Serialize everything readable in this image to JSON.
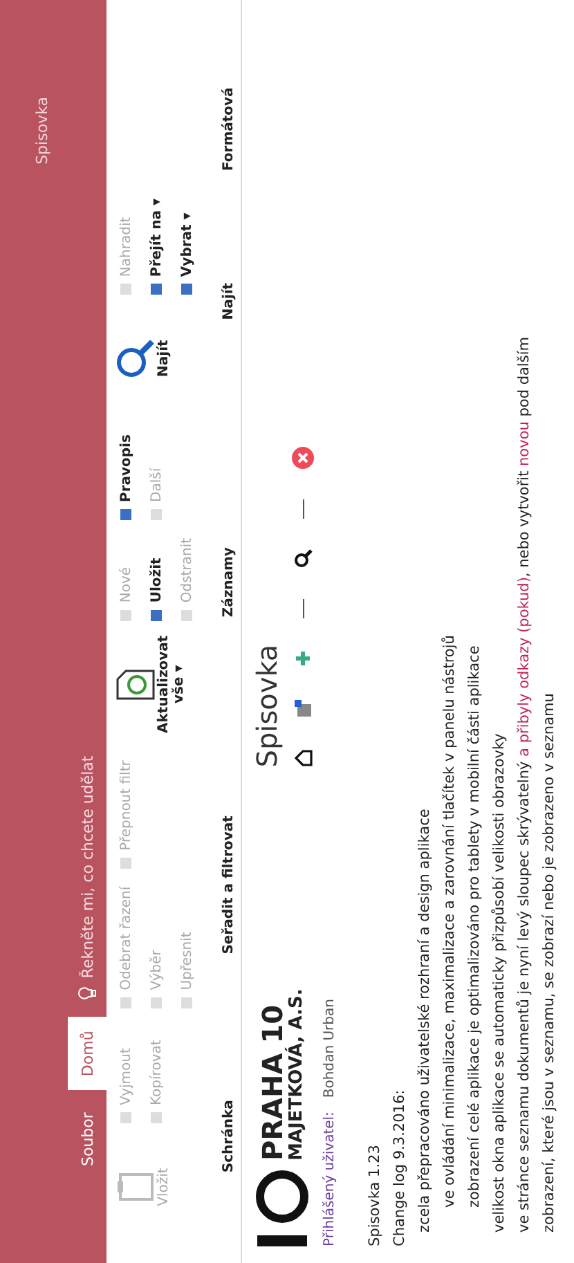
{
  "window": {
    "title": "Spisovka"
  },
  "tabs": [
    {
      "label": "Soubor",
      "selected": false
    },
    {
      "label": "Domů",
      "selected": true
    }
  ],
  "tell_me": {
    "placeholder": "Řekněte mi, co chcete udělat"
  },
  "ribbon": {
    "groups": [
      {
        "label": "Schránka",
        "large": {
          "label": "Vložit",
          "disabled": true
        },
        "columns": [
          [
            {
              "label": "Vyjmout",
              "disabled": true
            },
            {
              "label": "Kopírovat",
              "disabled": true
            }
          ]
        ]
      },
      {
        "label": "Seřadit a filtrovat",
        "columns": [
          [
            {
              "label": "Odebrat řazení",
              "disabled": true
            },
            {
              "label": "Výběr",
              "disabled": true
            },
            {
              "label": "Upřesnit",
              "disabled": true
            }
          ],
          [
            {
              "label": "Přepnout filtr",
              "disabled": true
            }
          ]
        ]
      },
      {
        "label": "Záznamy",
        "large": {
          "label": "Aktualizovat vše ▾",
          "disabled": false
        },
        "columns": [
          [
            {
              "label": "Nové",
              "disabled": true
            },
            {
              "label": "Uložit",
              "disabled": false
            },
            {
              "label": "Odstranit",
              "disabled": true
            }
          ],
          [
            {
              "label": "Pravopis",
              "disabled": false
            },
            {
              "label": "Další",
              "disabled": true
            }
          ]
        ]
      },
      {
        "label": "Najít",
        "large": {
          "label": "Najít",
          "disabled": false
        },
        "columns": [
          [
            {
              "label": "Nahradit",
              "disabled": true
            },
            {
              "label": "Přejít na ▾",
              "disabled": false
            },
            {
              "label": "Vybrat ▾",
              "disabled": false
            }
          ]
        ]
      },
      {
        "label": "Formátová"
      }
    ]
  },
  "logo": {
    "line_1": "PRAHA 10",
    "line_2": "MAJETKOVÁ, A.S."
  },
  "page_title": "Spisovka",
  "user": {
    "label": "Přihlášený uživatel:",
    "name": "Bohdan Urban"
  },
  "version": "Spisovka 1.23",
  "changelog": {
    "title": "Change log 9.3.2016:",
    "items": [
      {
        "segments": [
          {
            "text": "zcela přepracováno uživatelské rozhraní a design aplikace",
            "highlighted": false
          }
        ],
        "children": [
          {
            "segments": [
              {
                "text": "ve ovládání minimalizace, maximalizace a zarovnání tlačítek v panelu nástrojů",
                "highlighted": false
              }
            ]
          },
          {
            "segments": [
              {
                "text": "zobrazení celé aplikace je optimalizováno pro tablety v mobilní části aplikace",
                "highlighted": false
              }
            ]
          }
        ]
      },
      {
        "segments": [
          {
            "text": "velikost okna aplikace se automaticky přizpůsobí velikosti obrazovky",
            "highlighted": false
          }
        ]
      },
      {
        "segments": [
          {
            "text": "ve stránce seznamu dokumentů je nyní levý sloupec skrývatelný ",
            "highlighted": false
          },
          {
            "text": "a přibyly odkazy (pokud)",
            "highlighted": true
          },
          {
            "text": ", nebo vytvořit ",
            "highlighted": false
          },
          {
            "text": "novou",
            "highlighted": true
          },
          {
            "text": " pod dalším",
            "highlighted": false
          }
        ]
      },
      {
        "segments": [
          {
            "text": "zobrazení, které jsou v seznamu, se zobrazí nebo je zobrazeno v seznamu",
            "highlighted": false
          }
        ]
      }
    ]
  }
}
